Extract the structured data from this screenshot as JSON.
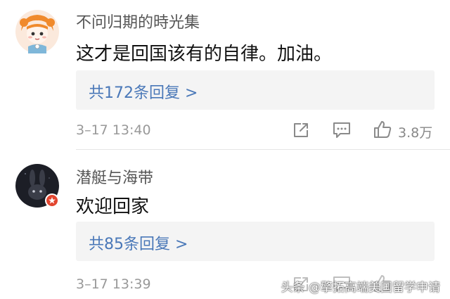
{
  "comments": [
    {
      "username": "不问归期的時光集",
      "text": "这才是回国该有的自律。加油。",
      "reply_label": "共172条回复 >",
      "timestamp": "3–17 13:40",
      "likes": "3.8万",
      "avatar": "anime-girl-avatar"
    },
    {
      "username": "潜艇与海带",
      "text": "欢迎回家",
      "reply_label": "共85条回复 >",
      "timestamp": "3–17 13:39",
      "avatar": "dark-bunny-avatar",
      "badge_color": "#e2452f"
    }
  ],
  "watermark": "头条 @擎拓高端美国留学申请",
  "colors": {
    "link": "#4a78b8",
    "muted": "#999999",
    "reply_bg": "#f4f4f4"
  }
}
